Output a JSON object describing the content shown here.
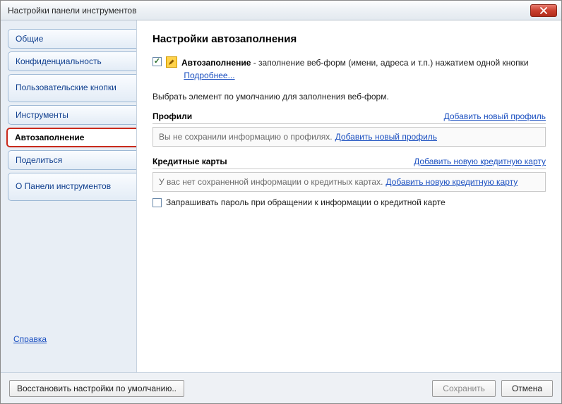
{
  "window": {
    "title": "Настройки панели инструментов"
  },
  "sidebar": {
    "items": [
      {
        "label": "Общие",
        "active": false
      },
      {
        "label": "Конфиденциальность",
        "active": false
      },
      {
        "label": "Пользовательские кнопки",
        "active": false,
        "multiline": true
      },
      {
        "label": "Инструменты",
        "active": false
      },
      {
        "label": "Автозаполнение",
        "active": true
      },
      {
        "label": "Поделиться",
        "active": false
      },
      {
        "label": "О Панели инструментов",
        "active": false,
        "multiline": true
      }
    ],
    "help_link": "Справка"
  },
  "main": {
    "heading": "Настройки автозаполнения",
    "autofill": {
      "checked": true,
      "name_bold": "Автозаполнение",
      "desc_tail": " - заполнение веб-форм (имени, адреса и т.п.) нажатием одной кнопки",
      "more_link": "Подробнее..."
    },
    "select_default_text": "Выбрать элемент по умолчанию для заполнения веб-форм.",
    "profiles": {
      "label": "Профили",
      "add_link": "Добавить новый профиль",
      "empty_text": "Вы не сохранили информацию о профилях.",
      "empty_link": "Добавить новый профиль"
    },
    "cards": {
      "label": "Кредитные карты",
      "add_link": "Добавить новую кредитную карту",
      "empty_text": "У вас нет сохраненной информации о кредитных картах.",
      "empty_link": "Добавить новую кредитную карту",
      "ask_password_checked": false,
      "ask_password_label": "Запрашивать пароль при обращении к информации о кредитной карте"
    }
  },
  "footer": {
    "restore_defaults": "Восстановить настройки по умолчанию..",
    "save": "Сохранить",
    "cancel": "Отмена"
  }
}
